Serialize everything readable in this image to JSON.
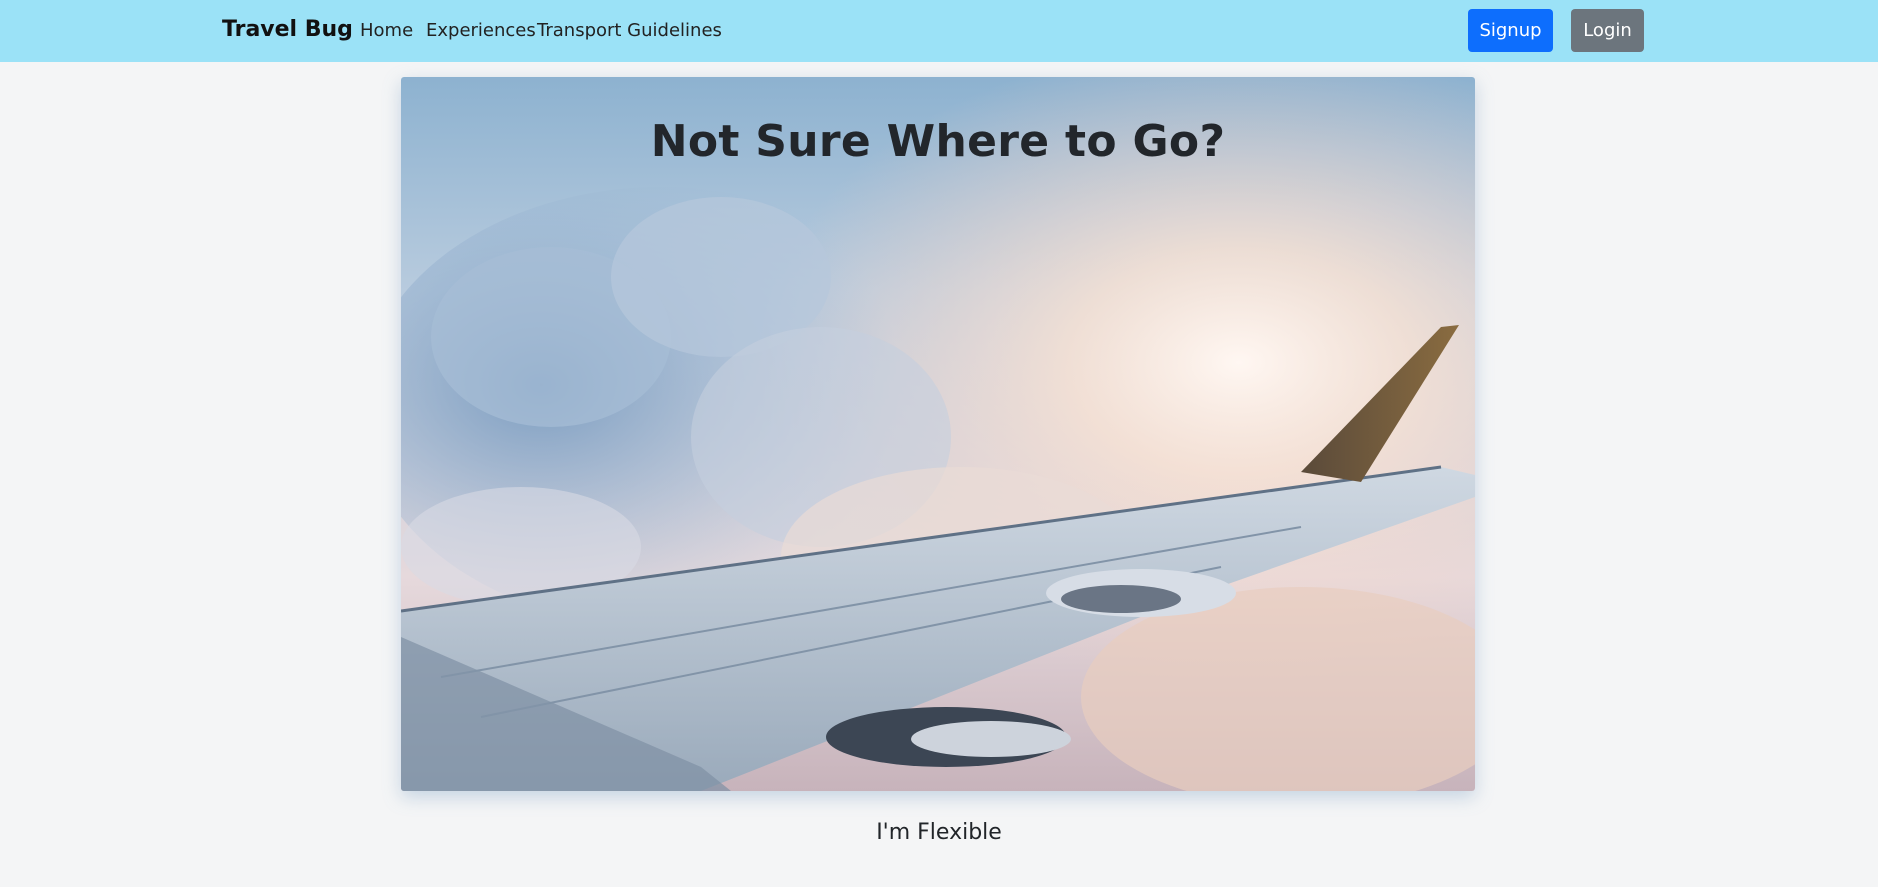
{
  "navbar": {
    "brand": "Travel Bug",
    "links": [
      "Home",
      "Experiences",
      "Transport Guidelines"
    ],
    "signup_label": "Signup",
    "login_label": "Login",
    "background_color": "#9be2f7",
    "signup_color": "#0d6efd",
    "login_color": "#6c757d"
  },
  "hero": {
    "title": "Not Sure Where to Go?",
    "image_icon": "airplane-wing-sky-image"
  },
  "flexible_link": "I'm Flexible"
}
